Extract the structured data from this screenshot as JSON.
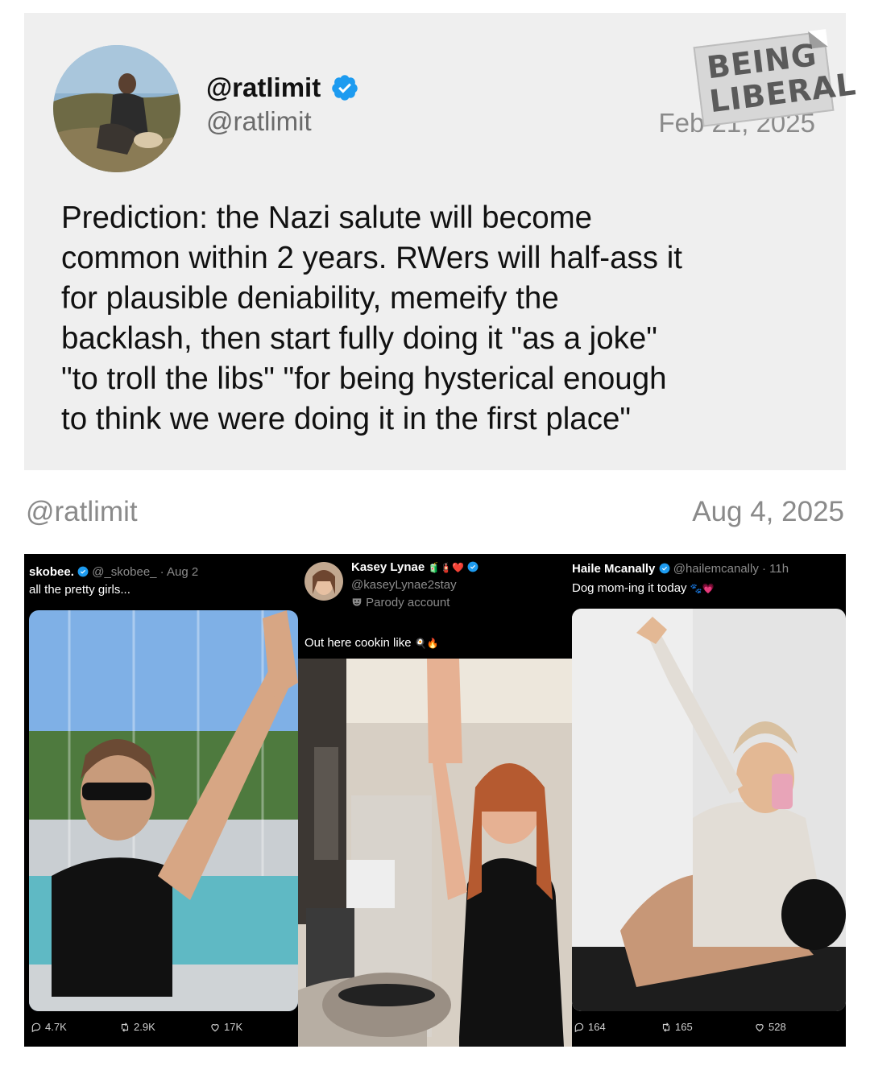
{
  "tweet": {
    "display_name": "@ratlimit",
    "handle": "@ratlimit",
    "date": "Feb 21, 2025",
    "lines": [
      "Prediction: the Nazi salute will become",
      "common within 2 years. RWers will half-ass it",
      "for plausible deniability, memeify the",
      "backlash, then start fully doing it \"as a joke\"",
      "\"to troll the libs\" \"for being hysterical enough",
      "to think we were doing it in the first place\""
    ]
  },
  "watermark": {
    "line1": "BEING",
    "line2": "LIBERAL"
  },
  "followup": {
    "handle": "@ratlimit",
    "date": "Aug 4, 2025"
  },
  "panels": [
    {
      "name": "skobee.",
      "handle": "@_skobee_",
      "time": "· Aug 2",
      "text": "all the pretty girls...",
      "stats": {
        "replies": "4.7K",
        "reposts": "2.9K",
        "likes": "17K"
      }
    },
    {
      "name": "Kasey Lynae",
      "name_emojis": "🧃🧯❤️",
      "handle": "@kaseyLynae2stay",
      "badge": "Parody account",
      "text": "Out here cookin like",
      "text_emojis": "🍳🔥"
    },
    {
      "name": "Haile Mcanally",
      "handle": "@hailemcanally",
      "time": "· 11h",
      "text": "Dog mom-ing it today",
      "text_emojis": "🐾💗",
      "stats": {
        "replies": "164",
        "reposts": "165",
        "likes": "528"
      }
    }
  ],
  "colors": {
    "card_bg": "#efefef",
    "verified": "#1d9bf0",
    "panel_bg": "#000000",
    "meta_gray": "#8a8a8a"
  },
  "icons": [
    "verified-badge-icon",
    "reply-icon",
    "repost-icon",
    "like-icon",
    "parody-mask-icon"
  ]
}
